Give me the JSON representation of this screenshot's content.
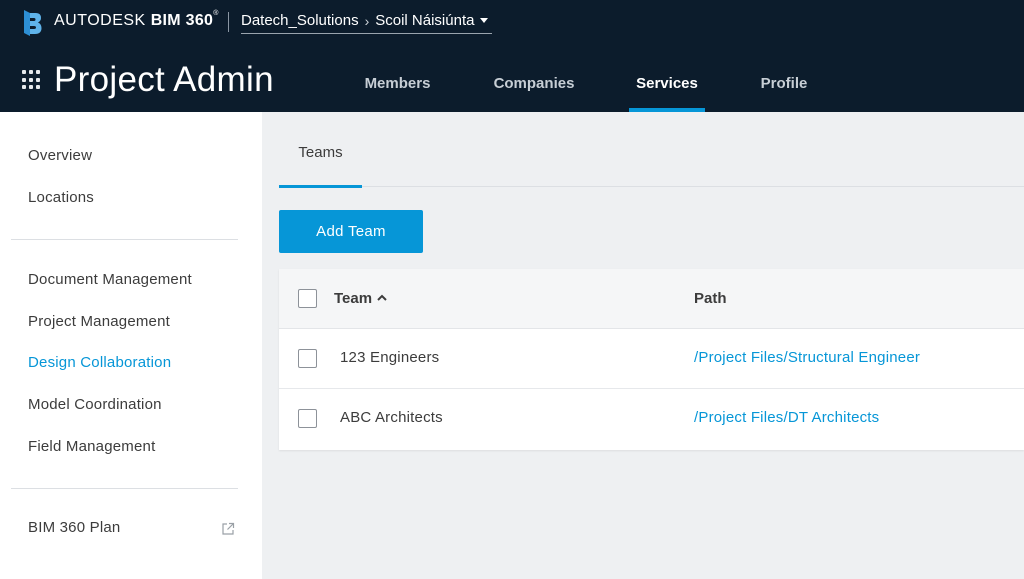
{
  "header": {
    "brand_prefix": "AUTODESK",
    "brand_product": "BIM 360",
    "brand_tm": "®",
    "account": "Datech_Solutions",
    "project": "Scoil Náisiúnta",
    "app_title": "Project Admin",
    "tabs": [
      {
        "label": "Members",
        "active": false
      },
      {
        "label": "Companies",
        "active": false
      },
      {
        "label": "Services",
        "active": true
      },
      {
        "label": "Profile",
        "active": false
      }
    ]
  },
  "sidebar": {
    "items": [
      {
        "label": "Overview",
        "active": false
      },
      {
        "label": "Locations",
        "active": false
      },
      {
        "label": "Document Management",
        "active": false
      },
      {
        "label": "Project Management",
        "active": false
      },
      {
        "label": "Design Collaboration",
        "active": true
      },
      {
        "label": "Model Coordination",
        "active": false
      },
      {
        "label": "Field Management",
        "active": false
      },
      {
        "label": "BIM 360 Plan",
        "active": false
      }
    ]
  },
  "main": {
    "sub_tab": "Teams",
    "add_button": "Add Team",
    "table": {
      "columns": [
        "Team",
        "Path"
      ],
      "sort_direction": "ascending",
      "rows": [
        {
          "team": "123 Engineers",
          "path": "/Project Files/Structural Engineer"
        },
        {
          "team": "ABC Architects",
          "path": "/Project Files/DT Architects"
        }
      ]
    }
  },
  "colors": {
    "header_bg": "#0c1c2c",
    "accent": "#0696d7",
    "page_bg": "#eef0f2"
  },
  "icons": [
    "bim360-logo-icon",
    "chevron-right-icon",
    "caret-down-icon",
    "app-grid-icon",
    "sort-ascending-icon",
    "external-link-icon"
  ]
}
